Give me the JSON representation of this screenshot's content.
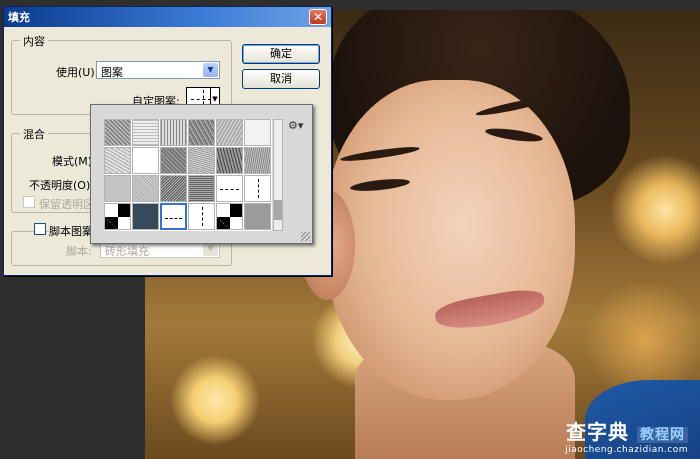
{
  "dialog": {
    "title": "填充",
    "close_glyph": "✕",
    "content_group": {
      "legend": "内容",
      "use_label": "使用(U):",
      "use_value": "图案",
      "custom_pattern_label": "自定图案:"
    },
    "blend_group": {
      "legend": "混合",
      "mode_label": "模式(M):",
      "opacity_label": "不透明度(O):",
      "preserve_label": "保留透明区域"
    },
    "script_group": {
      "script_pattern_label": "脚本图案",
      "script_label": "脚本:",
      "script_value": "砖形填充"
    },
    "buttons": {
      "ok": "确定",
      "cancel": "取消"
    }
  },
  "pattern_picker": {
    "menu_icon": "⚙▾"
  },
  "watermark": {
    "main_left": "查字典",
    "main_right": "教程网",
    "url": "jiaocheng.chazidian.com"
  }
}
